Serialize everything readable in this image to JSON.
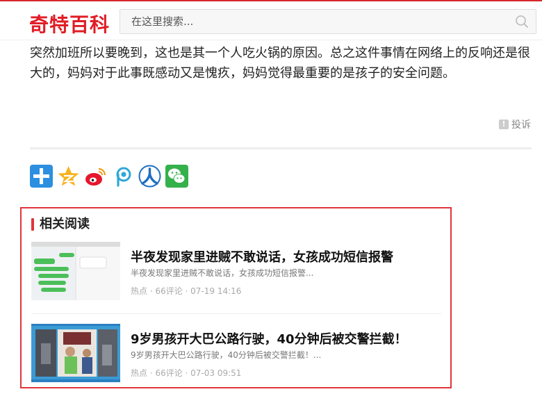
{
  "header": {
    "logo": "奇特百科",
    "search_placeholder": "在这里搜索..."
  },
  "article": {
    "text": "突然加班所以要晚到，这也是其一个人吃火锅的原因。总之这件事情在网络上的反响还是很大的，妈妈对于此事既感动又是愧疚，妈妈觉得最重要的是孩子的安全问题。"
  },
  "complain": {
    "icon_text": "!",
    "label": "投诉"
  },
  "share": {
    "icons": [
      "plus-share-icon",
      "qzone-star-icon",
      "weibo-icon",
      "p-share-icon",
      "renren-icon",
      "wechat-icon"
    ]
  },
  "related": {
    "title": "相关阅读",
    "items": [
      {
        "title": "半夜发现家里进贼不敢说话，女孩成功短信报警",
        "desc": "半夜发现家里进贼不敢说话，女孩成功短信报警...",
        "meta": "热点 · 66评论 · 07-19 14:16"
      },
      {
        "title": "9岁男孩开大巴公路行驶，40分钟后被交警拦截！",
        "desc": "9岁男孩开大巴公路行驶，40分钟后被交警拦截！...",
        "meta": "热点 · 66评论 · 07-03 09:51"
      }
    ]
  },
  "colors": {
    "brand_red": "#e01d26",
    "highlight_border": "#e0353b"
  }
}
